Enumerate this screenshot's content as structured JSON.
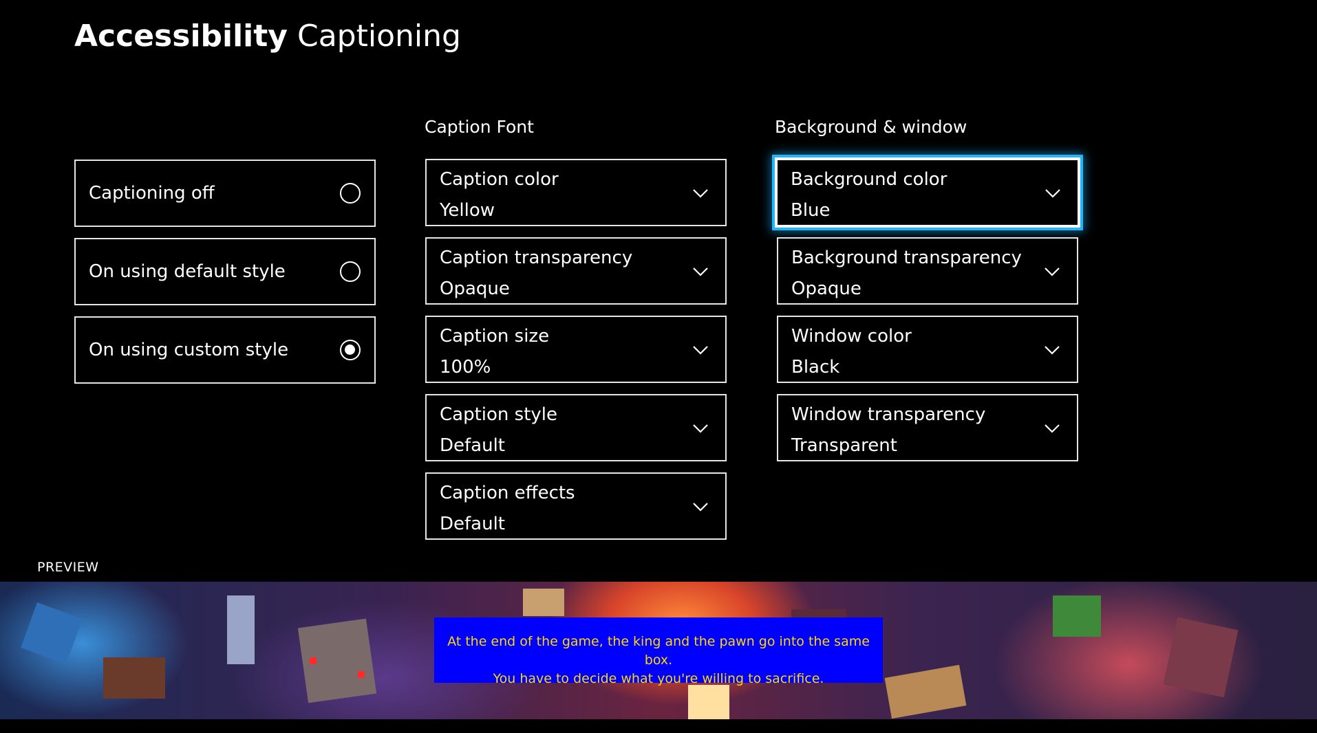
{
  "title": {
    "bold": "Accessibility",
    "light": "Captioning"
  },
  "columns": {
    "font_header": "Caption Font",
    "background_header": "Background & window"
  },
  "mode_options": [
    {
      "label": "Captioning off",
      "selected": false
    },
    {
      "label": "On using default style",
      "selected": false
    },
    {
      "label": "On using custom style",
      "selected": true
    }
  ],
  "caption_font": [
    {
      "label": "Caption color",
      "value": "Yellow"
    },
    {
      "label": "Caption transparency",
      "value": "Opaque"
    },
    {
      "label": "Caption size",
      "value": "100%"
    },
    {
      "label": "Caption style",
      "value": "Default"
    },
    {
      "label": "Caption effects",
      "value": "Default"
    }
  ],
  "background_window": [
    {
      "label": "Background color",
      "value": "Blue",
      "focused": true
    },
    {
      "label": "Background transparency",
      "value": "Opaque"
    },
    {
      "label": "Window color",
      "value": "Black"
    },
    {
      "label": "Window transparency",
      "value": "Transparent"
    }
  ],
  "preview": {
    "label": "PREVIEW",
    "caption_line1": "At the end of the game, the king and the pawn go into the same box.",
    "caption_line2": "You have to decide what you're willing to sacrifice.",
    "caption_text_color": "#ffd800",
    "caption_bg_color": "#0000ff"
  },
  "colors": {
    "focus_accent": "#1fb5ff",
    "background": "#000000"
  },
  "icons": {
    "dropdown": "chevron-down-icon",
    "radio": "radio-button-icon"
  }
}
